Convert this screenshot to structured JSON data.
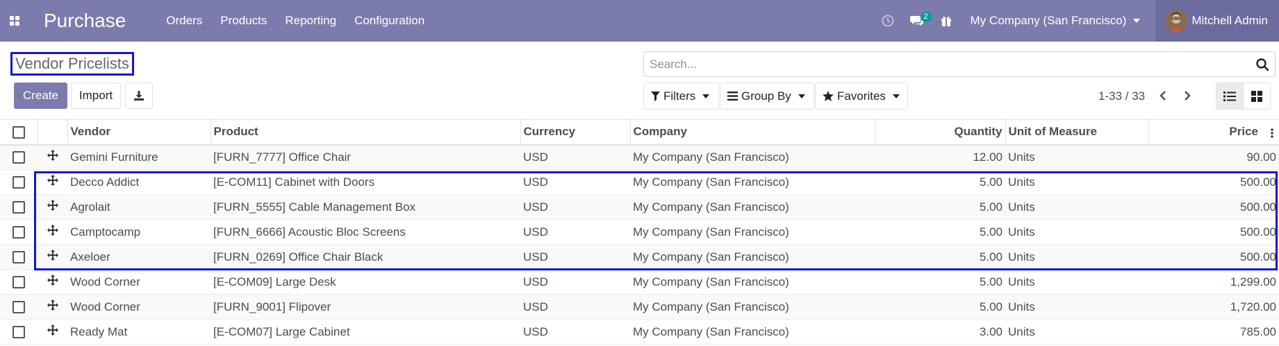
{
  "navbar": {
    "app_title": "Purchase",
    "menu": [
      "Orders",
      "Products",
      "Reporting",
      "Configuration"
    ],
    "messages_badge": "2",
    "company": "My Company (San Francisco)",
    "user": "Mitchell Admin",
    "bg_color": "#7c7bad"
  },
  "control_panel": {
    "title": "Vendor Pricelists",
    "create_label": "Create",
    "import_label": "Import",
    "search_placeholder": "Search...",
    "filters_label": "Filters",
    "groupby_label": "Group By",
    "favorites_label": "Favorites",
    "pager": "1-33 / 33"
  },
  "table": {
    "columns": [
      "Vendor",
      "Product",
      "Currency",
      "Company",
      "Quantity",
      "Unit of Measure",
      "Price"
    ],
    "rows": [
      {
        "vendor": "Gemini Furniture",
        "product": "[FURN_7777] Office Chair",
        "currency": "USD",
        "company": "My Company (San Francisco)",
        "quantity": "12.00",
        "uom": "Units",
        "price": "90.00"
      },
      {
        "vendor": "Decco Addict",
        "product": "[E-COM11] Cabinet with Doors",
        "currency": "USD",
        "company": "My Company (San Francisco)",
        "quantity": "5.00",
        "uom": "Units",
        "price": "500.00"
      },
      {
        "vendor": "Agrolait",
        "product": "[FURN_5555] Cable Management Box",
        "currency": "USD",
        "company": "My Company (San Francisco)",
        "quantity": "5.00",
        "uom": "Units",
        "price": "500.00"
      },
      {
        "vendor": "Camptocamp",
        "product": "[FURN_6666] Acoustic Bloc Screens",
        "currency": "USD",
        "company": "My Company (San Francisco)",
        "quantity": "5.00",
        "uom": "Units",
        "price": "500.00"
      },
      {
        "vendor": "Axeloer",
        "product": "[FURN_0269] Office Chair Black",
        "currency": "USD",
        "company": "My Company (San Francisco)",
        "quantity": "5.00",
        "uom": "Units",
        "price": "500.00"
      },
      {
        "vendor": "Wood Corner",
        "product": "[E-COM09] Large Desk",
        "currency": "USD",
        "company": "My Company (San Francisco)",
        "quantity": "5.00",
        "uom": "Units",
        "price": "1,299.00"
      },
      {
        "vendor": "Wood Corner",
        "product": "[FURN_9001] Flipover",
        "currency": "USD",
        "company": "My Company (San Francisco)",
        "quantity": "5.00",
        "uom": "Units",
        "price": "1,720.00"
      },
      {
        "vendor": "Ready Mat",
        "product": "[E-COM07] Large Cabinet",
        "currency": "USD",
        "company": "My Company (San Francisco)",
        "quantity": "3.00",
        "uom": "Units",
        "price": "785.00"
      }
    ]
  }
}
